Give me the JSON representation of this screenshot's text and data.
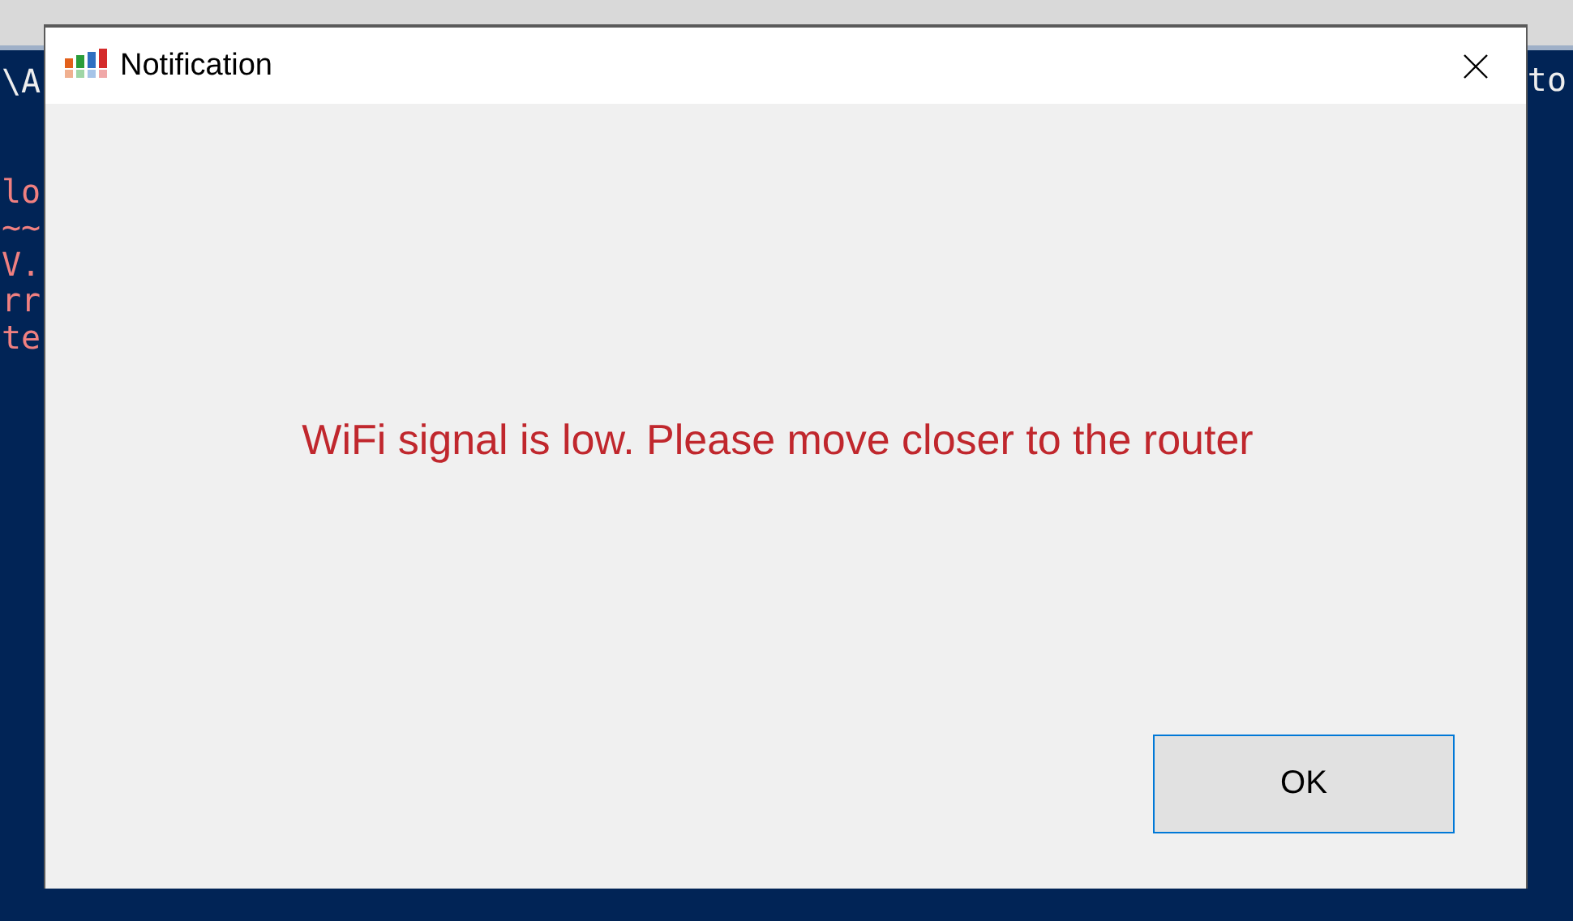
{
  "console": {
    "left_lines": [
      {
        "text": "\\A",
        "kind": "plain"
      },
      {
        "kind": "blank"
      },
      {
        "kind": "blank"
      },
      {
        "text": "lo",
        "kind": "error"
      },
      {
        "text": "~~",
        "kind": "error"
      },
      {
        "text": "V.",
        "kind": "error"
      },
      {
        "text": "rr",
        "kind": "error"
      },
      {
        "text": "te",
        "kind": "error"
      }
    ],
    "right_text": "to"
  },
  "dialog": {
    "title": "Notification",
    "message": "WiFi signal is low. Please move closer to the router",
    "buttons": [
      {
        "label": "OK",
        "selected": true
      }
    ]
  }
}
